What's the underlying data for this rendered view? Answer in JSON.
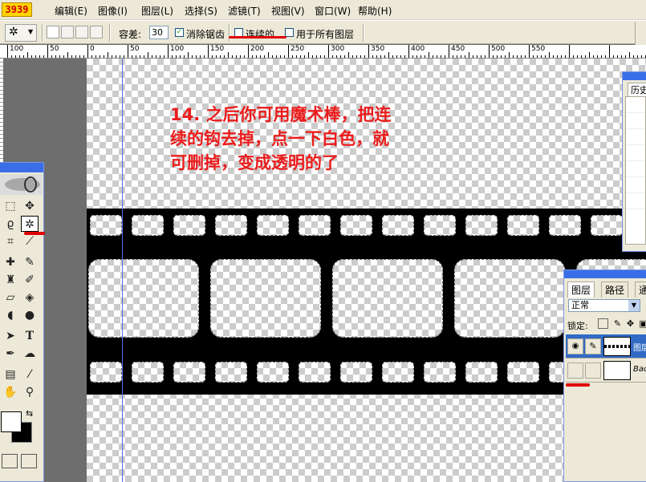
{
  "app": {
    "logo": "3939"
  },
  "menu": [
    "编辑(E)",
    "图像(I)",
    "图层(L)",
    "选择(S)",
    "滤镜(T)",
    "视图(V)",
    "窗口(W)",
    "帮助(H)"
  ],
  "options": {
    "tolerance_label": "容差:",
    "tolerance_value": "30",
    "antialias_label": "消除锯齿",
    "antialias_checked": "✓",
    "contiguous_label": "连续的",
    "all_layers_label": "用于所有图层"
  },
  "ruler": {
    "labels": [
      "100",
      "50",
      "0",
      "50",
      "100",
      "150",
      "200",
      "250",
      "300",
      "350",
      "400",
      "450",
      "500",
      "550"
    ]
  },
  "annotation": {
    "line1": "14. 之后你可用魔术棒，把连",
    "line2": "续的钩去掉，点一下白色，就",
    "line3": "可删掉，变成透明的了",
    "color": "#ec1c1c"
  },
  "tools": {
    "icons": [
      "marquee-icon",
      "move-icon",
      "lasso-icon",
      "magic-wand-icon",
      "crop-icon",
      "slice-icon",
      "healing-icon",
      "brush-icon",
      "stamp-icon",
      "history-brush-icon",
      "eraser-icon",
      "fill-icon",
      "blur-icon",
      "dodge-icon",
      "path-select-icon",
      "type-icon",
      "pen-icon",
      "shape-icon",
      "notes-icon",
      "eyedropper-icon",
      "hand-icon",
      "zoom-icon"
    ],
    "selected": "magic-wand-icon"
  },
  "history": {
    "tab": "历史"
  },
  "layers": {
    "tabs": [
      "图层",
      "路径",
      "通"
    ],
    "blend_mode": "正常",
    "lock_label": "锁定:",
    "rows": [
      {
        "name": "图层",
        "selected": true
      },
      {
        "name": "Bac",
        "selected": false
      }
    ]
  }
}
